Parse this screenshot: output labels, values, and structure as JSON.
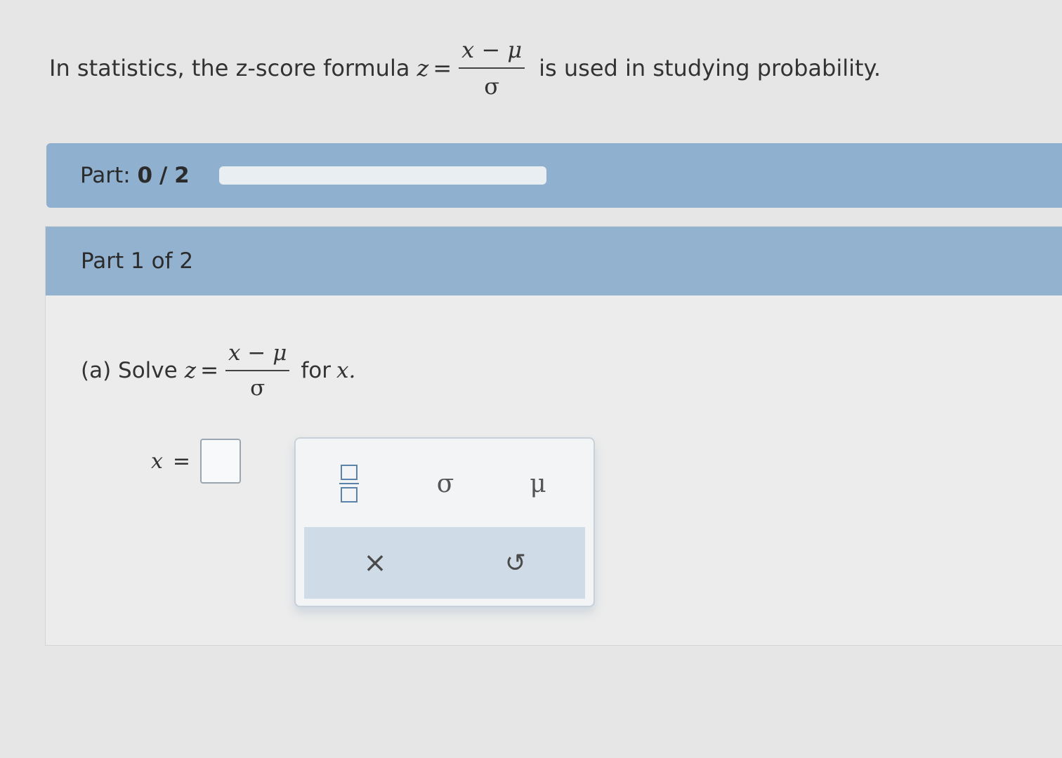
{
  "intro": {
    "prefix": "In statistics, the z-score formula",
    "var": "z",
    "equals": "=",
    "numerator": "x − μ",
    "denominator": "σ",
    "suffix": "is used in studying probability."
  },
  "progress": {
    "label": "Part:",
    "current": "0",
    "separator": "/",
    "total": "2",
    "fraction_complete": 0
  },
  "part_header": "Part 1 of 2",
  "question": {
    "prefix": "(a) Solve",
    "var": "z",
    "equals": "=",
    "numerator": "x − μ",
    "denominator": "σ",
    "suffix_for": "for",
    "suffix_var": "x."
  },
  "answer": {
    "var": "x",
    "equals": "=",
    "value": ""
  },
  "keypad": {
    "sigma": "σ",
    "mu": "μ",
    "clear": "×",
    "undo": "↺",
    "accent": "#5b82a8"
  }
}
